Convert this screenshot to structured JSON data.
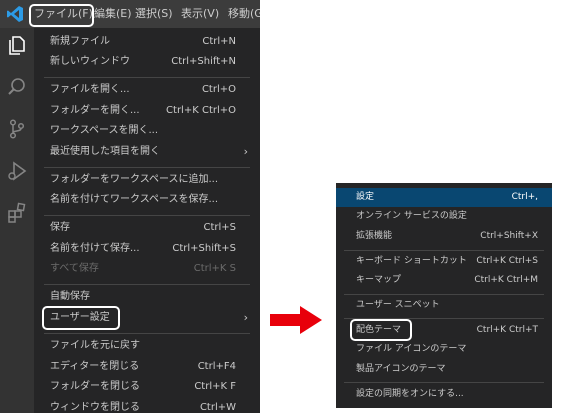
{
  "menubar": {
    "items": [
      "ファイル(F)",
      "編集(E)",
      "選択(S)",
      "表示(V)",
      "移動(G"
    ]
  },
  "activity_icons": [
    "explorer-icon",
    "search-icon",
    "source-control-icon",
    "run-debug-icon",
    "extensions-icon"
  ],
  "file_menu": {
    "items": [
      {
        "label": "新規ファイル",
        "shortcut": "Ctrl+N"
      },
      {
        "label": "新しいウィンドウ",
        "shortcut": "Ctrl+Shift+N"
      },
      {
        "label": "ファイルを開く...",
        "shortcut": "Ctrl+O"
      },
      {
        "label": "フォルダーを開く...",
        "shortcut": "Ctrl+K Ctrl+O"
      },
      {
        "label": "ワークスペースを開く...",
        "shortcut": ""
      },
      {
        "label": "最近使用した項目を開く",
        "shortcut": ""
      },
      {
        "label": "フォルダーをワークスペースに追加...",
        "shortcut": ""
      },
      {
        "label": "名前を付けてワークスペースを保存...",
        "shortcut": ""
      },
      {
        "label": "保存",
        "shortcut": "Ctrl+S"
      },
      {
        "label": "名前を付けて保存...",
        "shortcut": "Ctrl+Shift+S"
      },
      {
        "label": "すべて保存",
        "shortcut": "Ctrl+K S"
      },
      {
        "label": "自動保存",
        "shortcut": ""
      },
      {
        "label": "ユーザー設定",
        "shortcut": ""
      },
      {
        "label": "ファイルを元に戻す",
        "shortcut": ""
      },
      {
        "label": "エディターを閉じる",
        "shortcut": "Ctrl+F4"
      },
      {
        "label": "フォルダーを閉じる",
        "shortcut": "Ctrl+K F"
      },
      {
        "label": "ウィンドウを閉じる",
        "shortcut": "Ctrl+W"
      }
    ]
  },
  "preferences_menu": {
    "items": [
      {
        "label": "設定",
        "shortcut": "Ctrl+,"
      },
      {
        "label": "オンライン サービスの設定",
        "shortcut": ""
      },
      {
        "label": "拡張機能",
        "shortcut": "Ctrl+Shift+X"
      },
      {
        "label": "キーボード ショートカット",
        "shortcut": "Ctrl+K Ctrl+S"
      },
      {
        "label": "キーマップ",
        "shortcut": "Ctrl+K Ctrl+M"
      },
      {
        "label": "ユーザー スニペット",
        "shortcut": ""
      },
      {
        "label": "配色テーマ",
        "shortcut": "Ctrl+K Ctrl+T"
      },
      {
        "label": "ファイル アイコンのテーマ",
        "shortcut": ""
      },
      {
        "label": "製品アイコンのテーマ",
        "shortcut": ""
      },
      {
        "label": "設定の同期をオンにする...",
        "shortcut": ""
      }
    ]
  },
  "colors": {
    "menu_bg": "#252526",
    "active_item_bg": "#094771",
    "arrow": "#e8000b",
    "highlight_box": "#ffffff",
    "vscode_logo": "#2c9be6"
  }
}
